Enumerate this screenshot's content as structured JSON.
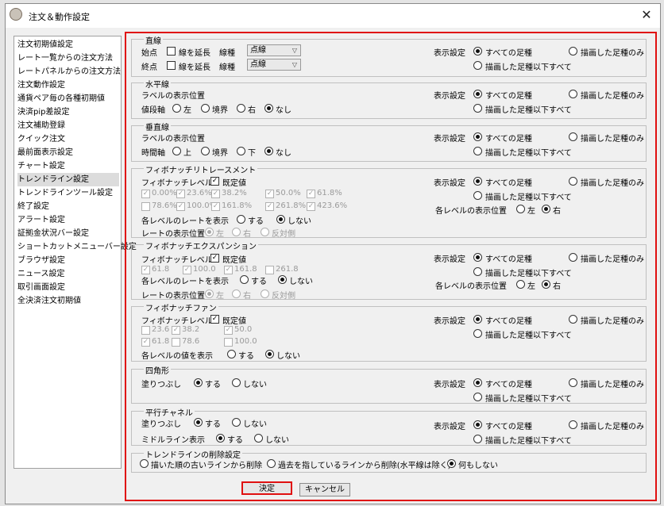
{
  "window": {
    "title": "注文＆動作設定"
  },
  "sidebar": {
    "items": [
      "注文初期値設定",
      "レート一覧からの注文方法",
      "レートパネルからの注文方法",
      "注文動作設定",
      "通貨ペア毎の各種初期値",
      "決済pip差設定",
      "注文補助登録",
      "クイック注文",
      "最前面表示設定",
      "チャート設定",
      "トレンドライン設定",
      "トレンドラインツール設定",
      "終了設定",
      "アラート設定",
      "証拠金状況バー設定",
      "ショートカットメニューバー設定",
      "ブラウザ設定",
      "ニュース設定",
      "取引画面設定",
      "全決済注文初期値"
    ],
    "selected": "トレンドライン設定"
  },
  "common": {
    "display_label": "表示設定",
    "opt_all": "すべての足種",
    "opt_drawn": "描画した足種のみ",
    "opt_below": "描画した足種以下すべて",
    "yes": "する",
    "no": "しない",
    "fib_level_label": "フィボナッチレベル",
    "default_label": "既定値",
    "show_level_rate": "各レベルのレートを表示",
    "rate_pos": "レートの表示位置",
    "left": "左",
    "right": "右",
    "opposite": "反対側",
    "level_pos": "各レベルの表示位置"
  },
  "line": {
    "title": "直線",
    "start": "始点",
    "end": "終点",
    "extend": "線を延長",
    "type": "線種",
    "start_value": "点線",
    "end_value": "点線"
  },
  "hline": {
    "title": "水平線",
    "label_pos": "ラベルの表示位置",
    "axis": "値段軸",
    "left": "左",
    "border": "境界",
    "right": "右",
    "none": "なし"
  },
  "vline": {
    "title": "垂直線",
    "label_pos": "ラベルの表示位置",
    "axis": "時間軸",
    "up": "上",
    "border": "境界",
    "down": "下",
    "none": "なし"
  },
  "fib_retrace": {
    "title": "フィボナッチリトレースメント",
    "levels_row1": [
      "0.00%",
      "23.6%",
      "38.2%",
      "50.0%",
      "61.8%"
    ],
    "levels_row2": [
      "78.6%",
      "100.0%",
      "161.8%",
      "261.8%",
      "423.6%"
    ]
  },
  "fib_expansion": {
    "title": "フィボナッチエクスパンション",
    "levels": [
      "61.8",
      "100.0",
      "161.8",
      "261.8"
    ]
  },
  "fib_fan": {
    "title": "フィボナッチファン",
    "levels_row1": [
      "23.6",
      "38.2",
      "50.0"
    ],
    "levels_row2": [
      "61.8",
      "78.6",
      "100.0"
    ],
    "show_value": "各レベルの値を表示"
  },
  "rect": {
    "title": "四角形",
    "fill": "塗りつぶし"
  },
  "channel": {
    "title": "平行チャネル",
    "fill": "塗りつぶし",
    "midline": "ミドルライン表示"
  },
  "delete": {
    "title": "トレンドラインの削除設定",
    "opt1": "描いた順の古いラインから削除",
    "opt2": "過去を指しているラインから削除(水平線は除く)",
    "opt3": "何もしない"
  },
  "buttons": {
    "ok": "決定",
    "cancel": "キャンセル"
  },
  "colors": {
    "highlight": "#e01010"
  }
}
